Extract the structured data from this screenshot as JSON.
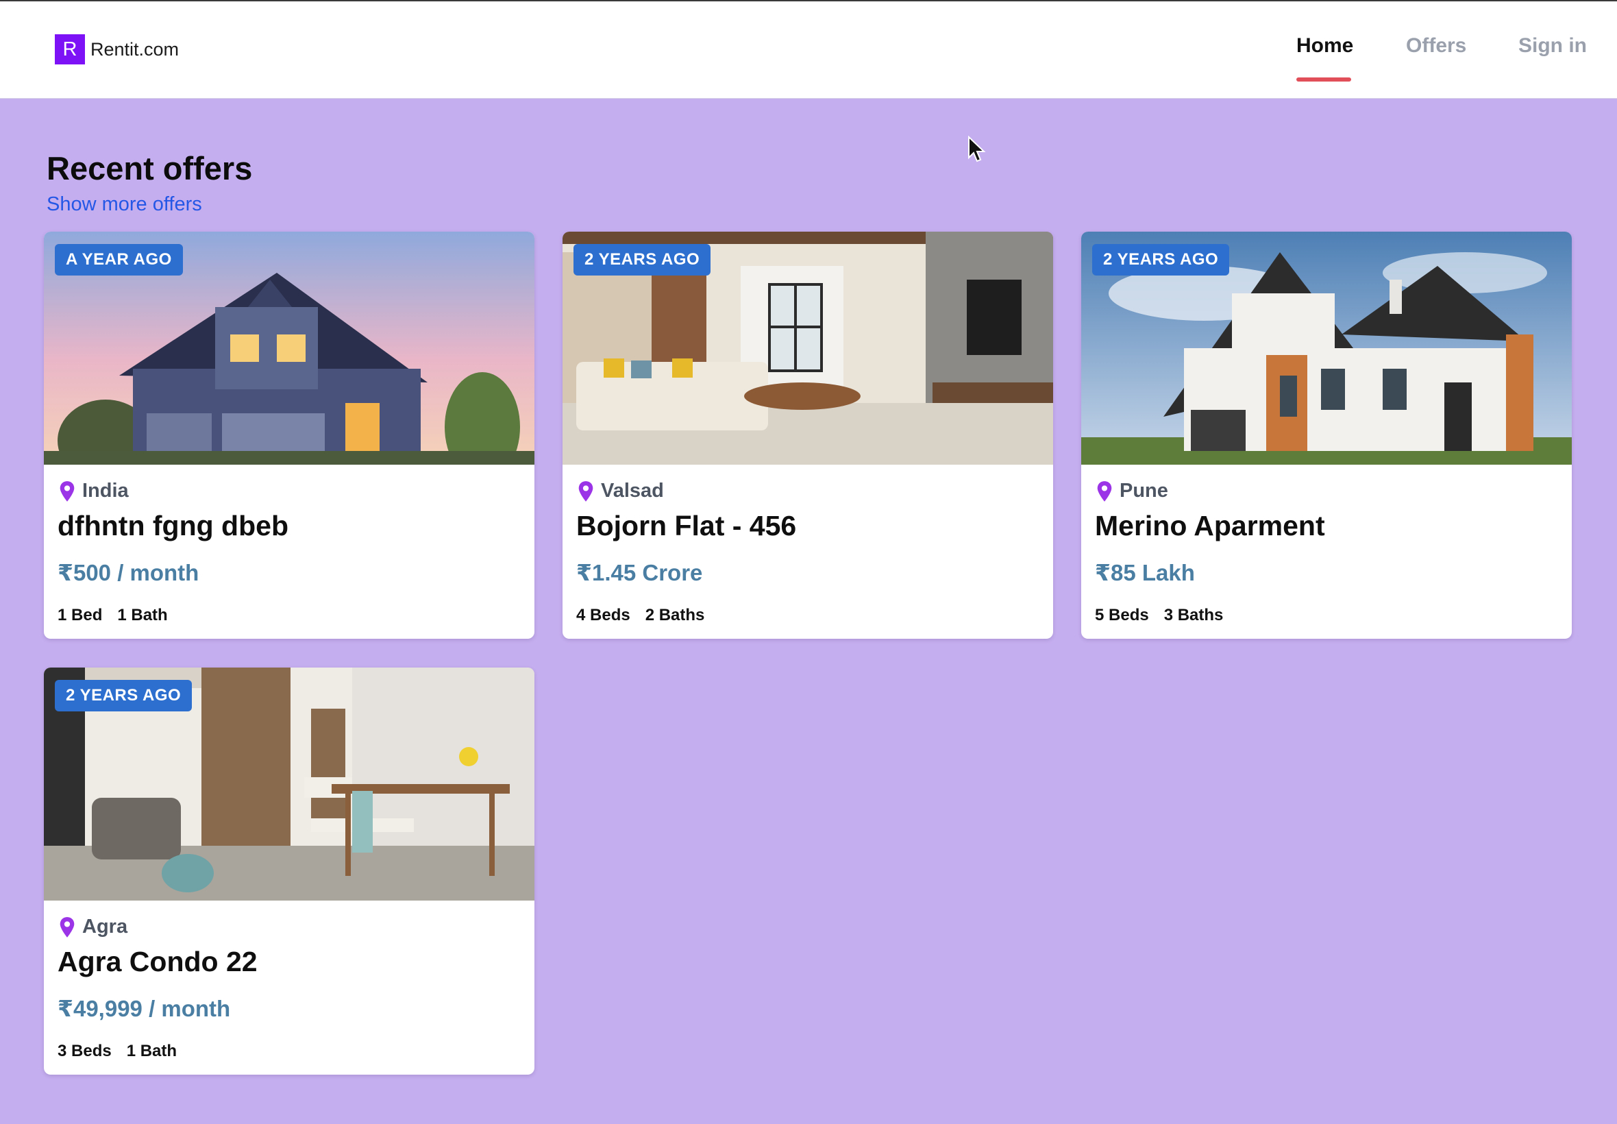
{
  "brand": {
    "logo_letter": "R",
    "name": "Rentit.com",
    "color": "#7c12f5"
  },
  "nav": {
    "home": "Home",
    "offers": "Offers",
    "signin": "Sign in",
    "active": "Home"
  },
  "section": {
    "title": "Recent offers",
    "more_link": "Show more offers"
  },
  "offers": [
    {
      "age": "A YEAR AGO",
      "location": "India",
      "title": "dfhntn fgng dbeb",
      "price": "₹500 / month",
      "beds": "1 Bed",
      "baths": "1 Bath",
      "image": "house-exterior-dusk"
    },
    {
      "age": "2 YEARS AGO",
      "location": "Valsad",
      "title": "Bojorn Flat - 456",
      "price": "₹1.45 Crore",
      "beds": "4 Beds",
      "baths": "2 Baths",
      "image": "living-room-interior"
    },
    {
      "age": "2 YEARS AGO",
      "location": "Pune",
      "title": "Merino Aparment",
      "price": "₹85 Lakh",
      "beds": "5 Beds",
      "baths": "3 Baths",
      "image": "white-house-exterior"
    },
    {
      "age": "2 YEARS AGO",
      "location": "Agra",
      "title": "Agra Condo 22",
      "price": "₹49,999 / month",
      "beds": "3 Beds",
      "baths": "1 Bath",
      "image": "condo-living-dining"
    }
  ],
  "colors": {
    "background": "#c5aeef",
    "badge": "#2d6fce",
    "price": "#4a7fa3",
    "pin": "#9b34e6",
    "nav_underline": "#e14f59",
    "link": "#2557e6"
  }
}
